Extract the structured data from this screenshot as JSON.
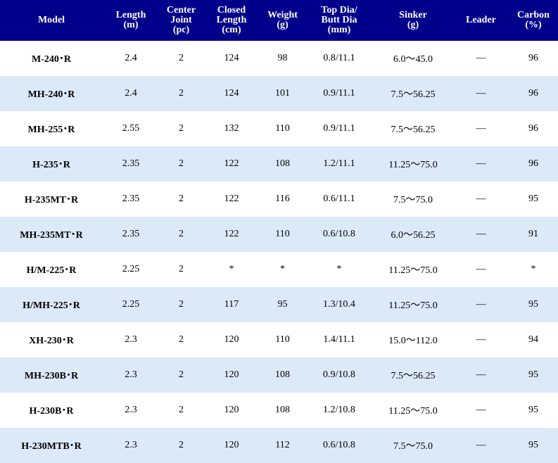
{
  "table": {
    "headers": [
      {
        "key": "model",
        "lines": [
          "Model"
        ]
      },
      {
        "key": "length",
        "lines": [
          "Length",
          "(m)"
        ]
      },
      {
        "key": "joint",
        "lines": [
          "Center",
          "Joint",
          "(pc)"
        ]
      },
      {
        "key": "closed",
        "lines": [
          "Closed",
          "Length",
          "(cm)"
        ]
      },
      {
        "key": "weight",
        "lines": [
          "Weight",
          "(g)"
        ]
      },
      {
        "key": "dia",
        "lines": [
          "Top Dia/",
          "Butt Dia",
          "(mm)"
        ]
      },
      {
        "key": "sinker",
        "lines": [
          "Sinker",
          "(g)"
        ]
      },
      {
        "key": "leader",
        "lines": [
          "Leader"
        ]
      },
      {
        "key": "carbon",
        "lines": [
          "Carbon",
          "(%)"
        ]
      }
    ],
    "rows": [
      [
        "M-240･R",
        "2.4",
        "2",
        "124",
        "98",
        "0.8/11.1",
        "6.0～45.0",
        "—",
        "96"
      ],
      [
        "MH-240･R",
        "2.4",
        "2",
        "124",
        "101",
        "0.9/11.1",
        "7.5～56.25",
        "—",
        "96"
      ],
      [
        "MH-255･R",
        "2.55",
        "2",
        "132",
        "110",
        "0.9/11.1",
        "7.5～56.25",
        "—",
        "96"
      ],
      [
        "H-235･R",
        "2.35",
        "2",
        "122",
        "108",
        "1.2/11.1",
        "11.25～75.0",
        "—",
        "96"
      ],
      [
        "H-235MT･R",
        "2.35",
        "2",
        "122",
        "116",
        "0.6/11.1",
        "7.5～75.0",
        "—",
        "95"
      ],
      [
        "MH-235MT･R",
        "2.35",
        "2",
        "122",
        "110",
        "0.6/10.8",
        "6.0～56.25",
        "—",
        "91"
      ],
      [
        "H/M-225･R",
        "2.25",
        "2",
        "*",
        "*",
        "*",
        "11.25～75.0",
        "—",
        "*"
      ],
      [
        "H/MH-225･R",
        "2.25",
        "2",
        "117",
        "95",
        "1.3/10.4",
        "11.25～75.0",
        "—",
        "95"
      ],
      [
        "XH-230･R",
        "2.3",
        "2",
        "120",
        "110",
        "1.4/11.1",
        "15.0～112.0",
        "—",
        "94"
      ],
      [
        "MH-230B･R",
        "2.3",
        "2",
        "120",
        "108",
        "0.9/10.8",
        "7.5～56.25",
        "—",
        "95"
      ],
      [
        "H-230B･R",
        "2.3",
        "2",
        "120",
        "108",
        "1.2/10.8",
        "11.25～75.0",
        "—",
        "95"
      ],
      [
        "H-230MTB･R",
        "2.3",
        "2",
        "120",
        "112",
        "0.6/10.8",
        "7.5～75.0",
        "—",
        "95"
      ]
    ]
  },
  "colors": {
    "header_bg": "#00008b",
    "header_text": "#ffffff",
    "row_alt_bg": "#dce9f9",
    "row_bg": "#ffffff"
  }
}
